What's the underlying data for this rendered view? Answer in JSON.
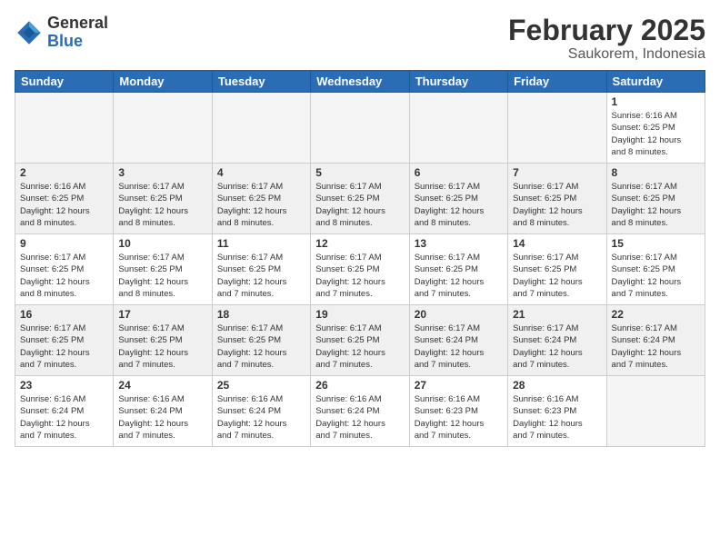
{
  "header": {
    "logo_general": "General",
    "logo_blue": "Blue",
    "month_title": "February 2025",
    "location": "Saukorem, Indonesia"
  },
  "weekdays": [
    "Sunday",
    "Monday",
    "Tuesday",
    "Wednesday",
    "Thursday",
    "Friday",
    "Saturday"
  ],
  "weeks": [
    [
      {
        "day": "",
        "info": ""
      },
      {
        "day": "",
        "info": ""
      },
      {
        "day": "",
        "info": ""
      },
      {
        "day": "",
        "info": ""
      },
      {
        "day": "",
        "info": ""
      },
      {
        "day": "",
        "info": ""
      },
      {
        "day": "1",
        "info": "Sunrise: 6:16 AM\nSunset: 6:25 PM\nDaylight: 12 hours\nand 8 minutes."
      }
    ],
    [
      {
        "day": "2",
        "info": "Sunrise: 6:16 AM\nSunset: 6:25 PM\nDaylight: 12 hours\nand 8 minutes."
      },
      {
        "day": "3",
        "info": "Sunrise: 6:17 AM\nSunset: 6:25 PM\nDaylight: 12 hours\nand 8 minutes."
      },
      {
        "day": "4",
        "info": "Sunrise: 6:17 AM\nSunset: 6:25 PM\nDaylight: 12 hours\nand 8 minutes."
      },
      {
        "day": "5",
        "info": "Sunrise: 6:17 AM\nSunset: 6:25 PM\nDaylight: 12 hours\nand 8 minutes."
      },
      {
        "day": "6",
        "info": "Sunrise: 6:17 AM\nSunset: 6:25 PM\nDaylight: 12 hours\nand 8 minutes."
      },
      {
        "day": "7",
        "info": "Sunrise: 6:17 AM\nSunset: 6:25 PM\nDaylight: 12 hours\nand 8 minutes."
      },
      {
        "day": "8",
        "info": "Sunrise: 6:17 AM\nSunset: 6:25 PM\nDaylight: 12 hours\nand 8 minutes."
      }
    ],
    [
      {
        "day": "9",
        "info": "Sunrise: 6:17 AM\nSunset: 6:25 PM\nDaylight: 12 hours\nand 8 minutes."
      },
      {
        "day": "10",
        "info": "Sunrise: 6:17 AM\nSunset: 6:25 PM\nDaylight: 12 hours\nand 8 minutes."
      },
      {
        "day": "11",
        "info": "Sunrise: 6:17 AM\nSunset: 6:25 PM\nDaylight: 12 hours\nand 7 minutes."
      },
      {
        "day": "12",
        "info": "Sunrise: 6:17 AM\nSunset: 6:25 PM\nDaylight: 12 hours\nand 7 minutes."
      },
      {
        "day": "13",
        "info": "Sunrise: 6:17 AM\nSunset: 6:25 PM\nDaylight: 12 hours\nand 7 minutes."
      },
      {
        "day": "14",
        "info": "Sunrise: 6:17 AM\nSunset: 6:25 PM\nDaylight: 12 hours\nand 7 minutes."
      },
      {
        "day": "15",
        "info": "Sunrise: 6:17 AM\nSunset: 6:25 PM\nDaylight: 12 hours\nand 7 minutes."
      }
    ],
    [
      {
        "day": "16",
        "info": "Sunrise: 6:17 AM\nSunset: 6:25 PM\nDaylight: 12 hours\nand 7 minutes."
      },
      {
        "day": "17",
        "info": "Sunrise: 6:17 AM\nSunset: 6:25 PM\nDaylight: 12 hours\nand 7 minutes."
      },
      {
        "day": "18",
        "info": "Sunrise: 6:17 AM\nSunset: 6:25 PM\nDaylight: 12 hours\nand 7 minutes."
      },
      {
        "day": "19",
        "info": "Sunrise: 6:17 AM\nSunset: 6:25 PM\nDaylight: 12 hours\nand 7 minutes."
      },
      {
        "day": "20",
        "info": "Sunrise: 6:17 AM\nSunset: 6:24 PM\nDaylight: 12 hours\nand 7 minutes."
      },
      {
        "day": "21",
        "info": "Sunrise: 6:17 AM\nSunset: 6:24 PM\nDaylight: 12 hours\nand 7 minutes."
      },
      {
        "day": "22",
        "info": "Sunrise: 6:17 AM\nSunset: 6:24 PM\nDaylight: 12 hours\nand 7 minutes."
      }
    ],
    [
      {
        "day": "23",
        "info": "Sunrise: 6:16 AM\nSunset: 6:24 PM\nDaylight: 12 hours\nand 7 minutes."
      },
      {
        "day": "24",
        "info": "Sunrise: 6:16 AM\nSunset: 6:24 PM\nDaylight: 12 hours\nand 7 minutes."
      },
      {
        "day": "25",
        "info": "Sunrise: 6:16 AM\nSunset: 6:24 PM\nDaylight: 12 hours\nand 7 minutes."
      },
      {
        "day": "26",
        "info": "Sunrise: 6:16 AM\nSunset: 6:24 PM\nDaylight: 12 hours\nand 7 minutes."
      },
      {
        "day": "27",
        "info": "Sunrise: 6:16 AM\nSunset: 6:23 PM\nDaylight: 12 hours\nand 7 minutes."
      },
      {
        "day": "28",
        "info": "Sunrise: 6:16 AM\nSunset: 6:23 PM\nDaylight: 12 hours\nand 7 minutes."
      },
      {
        "day": "",
        "info": ""
      }
    ]
  ]
}
